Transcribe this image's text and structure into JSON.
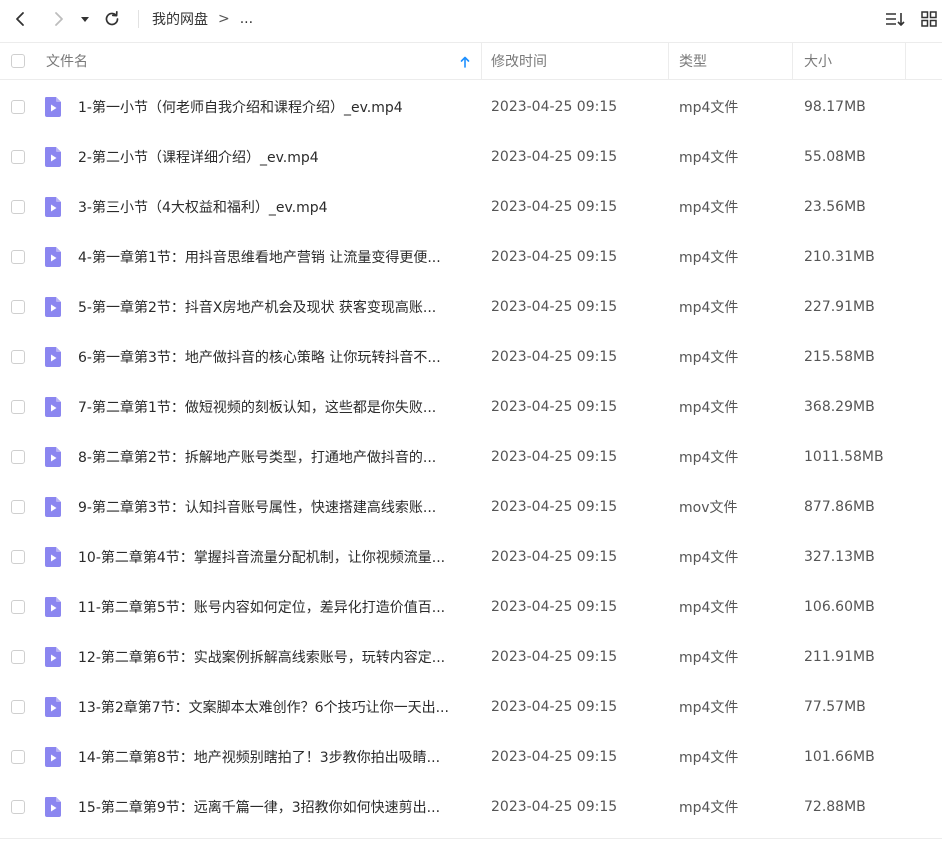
{
  "toolbar": {
    "back_icon": "chevron-left-icon",
    "forward_icon": "chevron-right-icon",
    "dropdown_icon": "caret-down-icon",
    "refresh_icon": "refresh-icon",
    "sort_icon": "sort-list-icon",
    "view_icon": "grid-view-icon"
  },
  "breadcrumb": {
    "root": "我的网盘",
    "separator": ">",
    "current": "..."
  },
  "columns": {
    "name": "文件名",
    "modified": "修改时间",
    "type": "类型",
    "size": "大小",
    "sort_indicator": "arrow-up-icon",
    "sort_color": "#1e90ff"
  },
  "colors": {
    "file_icon": "#8b86f0"
  },
  "files": [
    {
      "name": "1-第一小节（何老师自我介绍和课程介绍）_ev.mp4",
      "modified": "2023-04-25 09:15",
      "type": "mp4文件",
      "size": "98.17MB"
    },
    {
      "name": "2-第二小节（课程详细介绍）_ev.mp4",
      "modified": "2023-04-25 09:15",
      "type": "mp4文件",
      "size": "55.08MB"
    },
    {
      "name": "3-第三小节（4大权益和福利）_ev.mp4",
      "modified": "2023-04-25 09:15",
      "type": "mp4文件",
      "size": "23.56MB"
    },
    {
      "name": "4-第一章第1节：用抖音思维看地产营销 让流量变得更便...",
      "modified": "2023-04-25 09:15",
      "type": "mp4文件",
      "size": "210.31MB"
    },
    {
      "name": "5-第一章第2节：抖音X房地产机会及现状 获客变现高账...",
      "modified": "2023-04-25 09:15",
      "type": "mp4文件",
      "size": "227.91MB"
    },
    {
      "name": "6-第一章第3节：地产做抖音的核心策略 让你玩转抖音不...",
      "modified": "2023-04-25 09:15",
      "type": "mp4文件",
      "size": "215.58MB"
    },
    {
      "name": "7-第二章第1节：做短视频的刻板认知，这些都是你失败...",
      "modified": "2023-04-25 09:15",
      "type": "mp4文件",
      "size": "368.29MB"
    },
    {
      "name": "8-第二章第2节：拆解地产账号类型，打通地产做抖音的...",
      "modified": "2023-04-25 09:15",
      "type": "mp4文件",
      "size": "1011.58MB"
    },
    {
      "name": "9-第二章第3节：认知抖音账号属性，快速搭建高线索账...",
      "modified": "2023-04-25 09:15",
      "type": "mov文件",
      "size": "877.86MB"
    },
    {
      "name": "10-第二章第4节：掌握抖音流量分配机制，让你视频流量...",
      "modified": "2023-04-25 09:15",
      "type": "mp4文件",
      "size": "327.13MB"
    },
    {
      "name": "11-第二章第5节：账号内容如何定位，差异化打造价值百...",
      "modified": "2023-04-25 09:15",
      "type": "mp4文件",
      "size": "106.60MB"
    },
    {
      "name": "12-第二章第6节：实战案例拆解高线索账号，玩转内容定...",
      "modified": "2023-04-25 09:15",
      "type": "mp4文件",
      "size": "211.91MB"
    },
    {
      "name": "13-第2章第7节：文案脚本太难创作？6个技巧让你一天出...",
      "modified": "2023-04-25 09:15",
      "type": "mp4文件",
      "size": "77.57MB"
    },
    {
      "name": "14-第二章第8节：地产视频别瞎拍了！3步教你拍出吸睛...",
      "modified": "2023-04-25 09:15",
      "type": "mp4文件",
      "size": "101.66MB"
    },
    {
      "name": "15-第二章第9节：远离千篇一律，3招教你如何快速剪出...",
      "modified": "2023-04-25 09:15",
      "type": "mp4文件",
      "size": "72.88MB"
    }
  ]
}
